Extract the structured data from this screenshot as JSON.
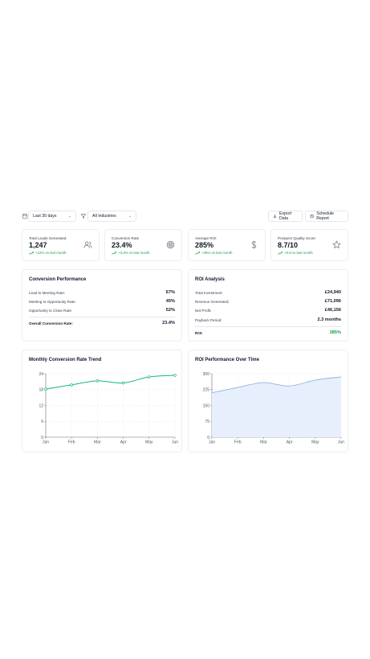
{
  "toolbar": {
    "date_range": "Last 30 days",
    "industry": "All Industries",
    "export_label": "Export Data",
    "schedule_label": "Schedule Report"
  },
  "kpis": [
    {
      "label": "Total Leads Generated",
      "value": "1,247",
      "change": "+12% vs last month",
      "icon": "users-icon"
    },
    {
      "label": "Conversion Rate",
      "value": "23.4%",
      "change": "+3.2% vs last month",
      "icon": "target-icon"
    },
    {
      "label": "Average ROI",
      "value": "285%",
      "change": "+45% vs last month",
      "icon": "dollar-icon"
    },
    {
      "label": "Prospect Quality Score",
      "value": "8.7/10",
      "change": "+0.8 vs last month",
      "icon": "star-icon"
    }
  ],
  "conversion": {
    "title": "Conversion Performance",
    "rows": [
      {
        "label": "Lead to Meeting Rate:",
        "value": "67%"
      },
      {
        "label": "Meeting to Opportunity Rate:",
        "value": "45%"
      },
      {
        "label": "Opportunity to Close Rate:",
        "value": "52%"
      }
    ],
    "overall_label": "Overall Conversion Rate:",
    "overall_value": "23.4%"
  },
  "roi": {
    "title": "ROI Analysis",
    "rows": [
      {
        "label": "Total Investment:",
        "value": "£24,940"
      },
      {
        "label": "Revenue Generated:",
        "value": "£71,096"
      },
      {
        "label": "Net Profit:",
        "value": "£46,156"
      },
      {
        "label": "Payback Period:",
        "value": "2.3 months"
      }
    ],
    "roi_label": "ROI:",
    "roi_value": "285%"
  },
  "chart_data": [
    {
      "type": "line",
      "title": "Monthly Conversion Rate Trend",
      "categories": [
        "Jan",
        "Feb",
        "Mar",
        "Apr",
        "May",
        "Jun"
      ],
      "series": [
        {
          "values": [
            18.2,
            19.8,
            21.3,
            20.5,
            22.8,
            23.4
          ]
        }
      ],
      "yticks": [
        0,
        6,
        12,
        18,
        24
      ],
      "ylim": [
        0,
        24
      ],
      "grid": true,
      "color": "#10b981"
    },
    {
      "type": "area",
      "title": "ROI Performance Over Time",
      "categories": [
        "Jan",
        "Feb",
        "Mar",
        "Apr",
        "May",
        "Jun"
      ],
      "series": [
        {
          "values": [
            210,
            235,
            258,
            242,
            270,
            285
          ]
        }
      ],
      "yticks": [
        0,
        75,
        150,
        225,
        300
      ],
      "ylim": [
        0,
        300
      ],
      "grid": true,
      "color": "#93b4e0",
      "fill": "#e6effb"
    }
  ]
}
